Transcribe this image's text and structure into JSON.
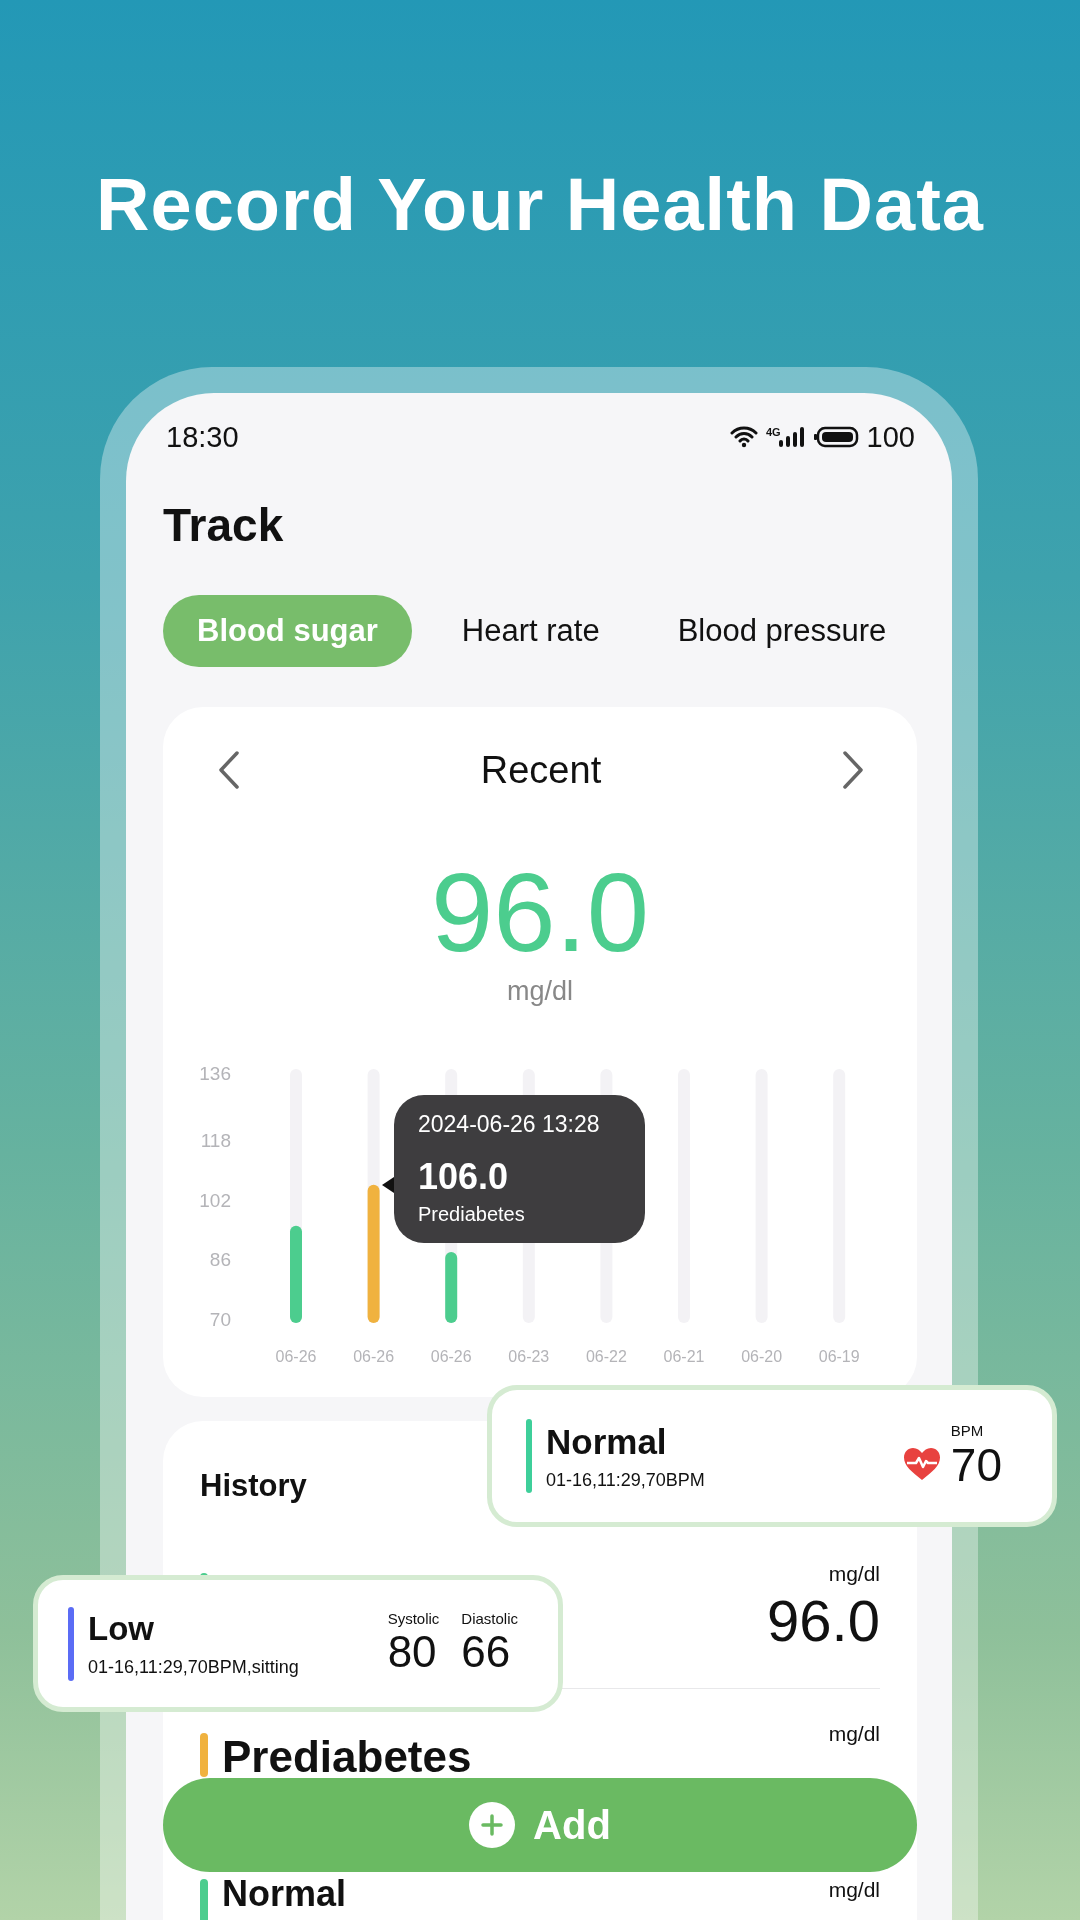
{
  "headline": "Record Your Health Data",
  "status_bar": {
    "time": "18:30",
    "network": "4G",
    "battery": "100"
  },
  "title": "Track",
  "tabs": [
    {
      "label": "Blood sugar",
      "selected": true
    },
    {
      "label": "Heart rate",
      "selected": false
    },
    {
      "label": "Blood pressure",
      "selected": false
    }
  ],
  "summary": {
    "period": "Recent",
    "value": "96.0",
    "unit": "mg/dl",
    "chart_data": {
      "type": "bar",
      "categories": [
        "06-26",
        "06-26",
        "06-26",
        "06-23",
        "06-22",
        "06-21",
        "06-20",
        "06-19"
      ],
      "series": [
        {
          "color": "#4ccd8e",
          "values": [
            95,
            null,
            88,
            null,
            null,
            null,
            null,
            null
          ]
        },
        {
          "color": "#f0b23f",
          "values": [
            null,
            106,
            null,
            null,
            null,
            null,
            null,
            null
          ]
        }
      ],
      "grid": "x",
      "ylim": [
        70,
        136
      ],
      "yticks": [
        70,
        86,
        102,
        118,
        136
      ]
    },
    "tooltip": {
      "time": "2024-06-26 13:28",
      "value": "106.0",
      "status": "Prediabetes"
    }
  },
  "history": {
    "title": "History",
    "rows": [
      {
        "color": "#4ccd8e",
        "unit": "mg/dl",
        "value": "96.0"
      },
      {
        "status": "Prediabetes",
        "color": "#f0b23f",
        "unit": "mg/dl"
      },
      {
        "status": "Normal",
        "color": "#4ccd8e",
        "unit": "mg/dl"
      }
    ]
  },
  "floating_cards": [
    {
      "kind": "heart_rate",
      "status": "Normal",
      "color": "#3ecf9a",
      "detail": "01-16,11:29,70BPM",
      "unit": "BPM",
      "value": "70"
    },
    {
      "kind": "blood_pressure",
      "status": "Low",
      "color": "#5b6cf5",
      "detail": "01-16,11:29,70BPM,sitting",
      "readings": [
        {
          "label": "Systolic",
          "value": "80"
        },
        {
          "label": "Diastolic",
          "value": "66"
        }
      ]
    }
  ],
  "add_button": {
    "label": "Add"
  }
}
